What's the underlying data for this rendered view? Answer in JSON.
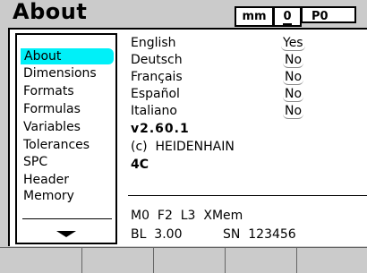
{
  "title": "About",
  "status": {
    "units": "mm",
    "zero": "0",
    "preset": "P0"
  },
  "menu": {
    "items": [
      "About",
      "Dimensions",
      "Formats",
      "Formulas",
      "Variables",
      "Tolerances",
      "SPC",
      "Header",
      "Memory"
    ],
    "selected": "About",
    "scroll_icon": "down-arrow-icon"
  },
  "languages": [
    {
      "name": "English",
      "value": "Yes"
    },
    {
      "name": "Deutsch",
      "value": "No"
    },
    {
      "name": "Français",
      "value": "No"
    },
    {
      "name": "Español",
      "value": "No"
    },
    {
      "name": "Italiano",
      "value": "No"
    }
  ],
  "info": {
    "version": "v2.60.1",
    "copyright": "(c)  HEIDENHAIN",
    "model": "4C",
    "config": "M0  F2  L3  XMem",
    "bl": "BL  3.00",
    "sn": "SN  123456"
  },
  "colors": {
    "background": "#cbcbcb",
    "highlight": "#00f0f8"
  }
}
